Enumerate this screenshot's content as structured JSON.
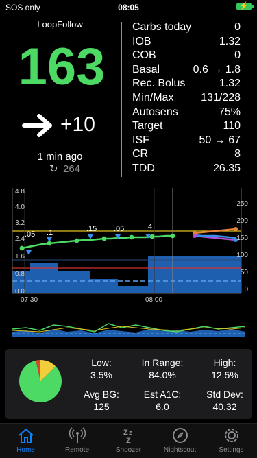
{
  "status": {
    "carrier": "SOS only",
    "time": "08:05",
    "battery_color": "#34c759"
  },
  "app_name": "LoopFollow",
  "bg": {
    "value": "163",
    "delta": "+10",
    "ago": "1 min ago",
    "since_count": "264",
    "color": "#4cd964"
  },
  "stats": [
    {
      "label": "Carbs today",
      "value": "0"
    },
    {
      "label": "IOB",
      "value": "1.32"
    },
    {
      "label": "COB",
      "value": "0"
    },
    {
      "label": "Basal",
      "value": "0.6 → 1.8"
    },
    {
      "label": "Rec. Bolus",
      "value": "1.32"
    },
    {
      "label": "Min/Max",
      "value": "131/228"
    },
    {
      "label": "Autosens",
      "value": "75%"
    },
    {
      "label": "Target",
      "value": "110"
    },
    {
      "label": "ISF",
      "value": "50 → 67"
    },
    {
      "label": "CR",
      "value": "8"
    },
    {
      "label": "TDD",
      "value": "26.35"
    }
  ],
  "chart": {
    "left_axis": [
      "4.8",
      "4.0",
      "3.2",
      "2.4",
      "1.6",
      "0.8",
      "0.0"
    ],
    "right_axis": [
      "250",
      "200",
      "150",
      "100",
      "50",
      "0"
    ],
    "time_labels": [
      "07:30",
      "08:00"
    ],
    "bolus_labels": [
      ".05",
      ".1",
      ".15",
      ".05",
      ".4"
    ]
  },
  "summary": {
    "low_label": "Low:",
    "low_value": "3.5%",
    "range_label": "In Range:",
    "range_value": "84.0%",
    "high_label": "High:",
    "high_value": "12.5%",
    "avg_label": "Avg BG:",
    "avg_value": "125",
    "a1c_label": "Est A1C:",
    "a1c_value": "6.0",
    "sd_label": "Std Dev:",
    "sd_value": "40.32",
    "pie": {
      "low": 3.5,
      "in_range": 84.0,
      "high": 12.5
    }
  },
  "tabs": [
    {
      "label": "Home",
      "icon": "home-icon",
      "active": true
    },
    {
      "label": "Remote",
      "icon": "antenna-icon"
    },
    {
      "label": "Snoozer",
      "icon": "snooze-icon"
    },
    {
      "label": "Nightscout",
      "icon": "compass-icon"
    },
    {
      "label": "Settings",
      "icon": "gear-icon"
    }
  ]
}
